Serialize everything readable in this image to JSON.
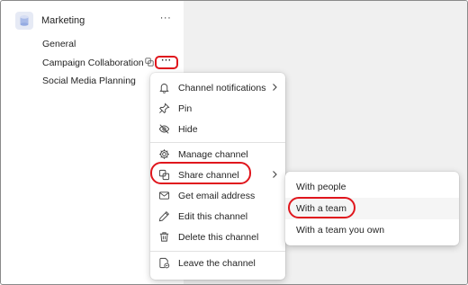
{
  "team": {
    "name": "Marketing",
    "more": "···",
    "avatar_icon": "team-cylinder-icon"
  },
  "channels": [
    {
      "label": "General"
    },
    {
      "label": "Campaign Collaboration"
    },
    {
      "label": "Social Media Planning"
    }
  ],
  "channel_more": "···",
  "context_menu": {
    "items": [
      {
        "label": "Channel notifications",
        "icon": "bell-icon",
        "has_submenu": true
      },
      {
        "label": "Pin",
        "icon": "pin-icon"
      },
      {
        "label": "Hide",
        "icon": "eye-off-icon"
      },
      {
        "label": "Manage channel",
        "icon": "gear-icon"
      },
      {
        "label": "Share channel",
        "icon": "share-channel-icon",
        "has_submenu": true
      },
      {
        "label": "Get email address",
        "icon": "mail-icon"
      },
      {
        "label": "Edit this channel",
        "icon": "pencil-icon"
      },
      {
        "label": "Delete this channel",
        "icon": "trash-icon"
      },
      {
        "label": "Leave the channel",
        "icon": "leave-icon"
      }
    ]
  },
  "share_submenu": {
    "items": [
      {
        "label": "With people"
      },
      {
        "label": "With a team"
      },
      {
        "label": "With a team you own"
      }
    ]
  },
  "colors": {
    "highlight": "#e0161d",
    "main_bg": "#f0f0f0",
    "text": "#242424"
  }
}
